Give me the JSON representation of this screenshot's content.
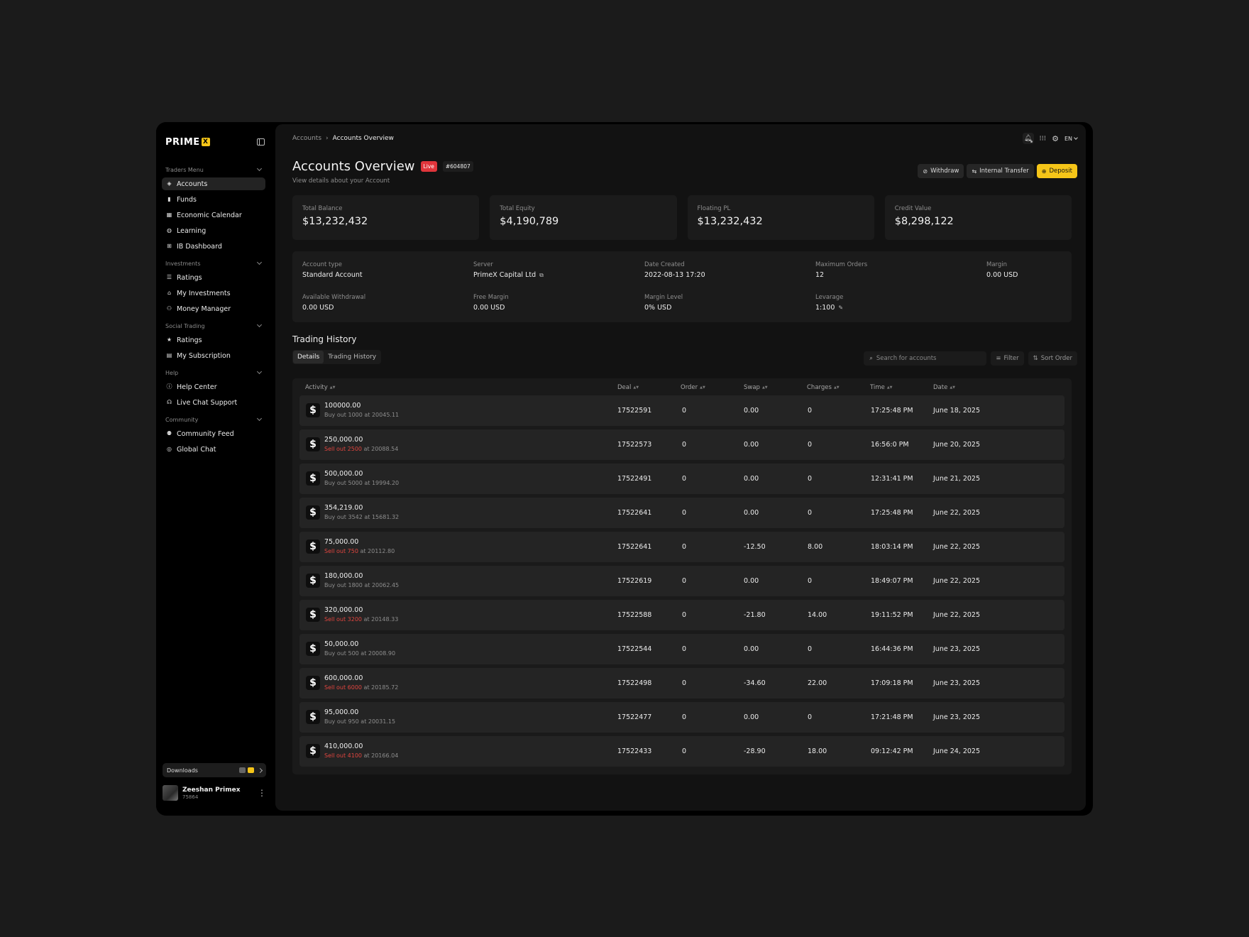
{
  "brand": {
    "logo_text": "PRIME",
    "logo_mark": "X"
  },
  "sidebar": {
    "sections": [
      {
        "label": "Traders Menu",
        "items": [
          {
            "label": "Accounts",
            "icon": "layers-icon",
            "active": true
          },
          {
            "label": "Funds",
            "icon": "chart-icon"
          },
          {
            "label": "Economic Calendar",
            "icon": "calendar-icon"
          },
          {
            "label": "Learning",
            "icon": "book-icon"
          },
          {
            "label": "IB Dashboard",
            "icon": "dashboard-icon"
          }
        ]
      },
      {
        "label": "Investments",
        "items": [
          {
            "label": "Ratings",
            "icon": "list-icon"
          },
          {
            "label": "My Investments",
            "icon": "bank-icon"
          },
          {
            "label": "Money Manager",
            "icon": "users-icon"
          }
        ]
      },
      {
        "label": "Social Trading",
        "items": [
          {
            "label": "Ratings",
            "icon": "star-icon"
          },
          {
            "label": "My Subscription",
            "icon": "subscription-icon"
          }
        ]
      },
      {
        "label": "Help",
        "items": [
          {
            "label": "Help Center",
            "icon": "help-icon"
          },
          {
            "label": "Live Chat Support",
            "icon": "headset-icon"
          }
        ]
      },
      {
        "label": "Community",
        "items": [
          {
            "label": "Community Feed",
            "icon": "people-icon"
          },
          {
            "label": "Global Chat",
            "icon": "globe-icon"
          }
        ]
      }
    ],
    "downloads_label": "Downloads",
    "user": {
      "name": "Zeeshan Primex",
      "id": "75864"
    }
  },
  "breadcrumb": {
    "parent": "Accounts",
    "separator": "›",
    "current": "Accounts Overview"
  },
  "topbar": {
    "language": "EN"
  },
  "header": {
    "title": "Accounts Overview",
    "status_badge": "Live",
    "account_number": "#604807",
    "subtitle": "View details about your Account",
    "withdraw_label": "Withdraw",
    "transfer_label": "Internal Transfer",
    "deposit_label": "Deposit"
  },
  "stats": [
    {
      "label": "Total Balance",
      "value": "$13,232,432"
    },
    {
      "label": "Total Equity",
      "value": "$4,190,789"
    },
    {
      "label": "Floating PL",
      "value": "$13,232,432"
    },
    {
      "label": "Credit Value",
      "value": "$8,298,122"
    }
  ],
  "account_details": {
    "account_type": {
      "label": "Account type",
      "value": "Standard Account"
    },
    "server": {
      "label": "Server",
      "value": "PrimeX Capital Ltd"
    },
    "date_created": {
      "label": "Date Created",
      "value": "2022-08-13 17:20"
    },
    "max_orders": {
      "label": "Maximum Orders",
      "value": "12"
    },
    "margin": {
      "label": "Margin",
      "value": "0.00 USD"
    },
    "available_withdrawal": {
      "label": "Available Withdrawal",
      "value": "0.00 USD"
    },
    "free_margin": {
      "label": "Free Margin",
      "value": "0.00 USD"
    },
    "margin_level": {
      "label": "Margin Level",
      "value": "0% USD"
    },
    "leverage": {
      "label": "Levarage",
      "value": "1:100"
    }
  },
  "trading": {
    "title": "Trading History",
    "tabs": [
      "Details",
      "Trading History"
    ],
    "search_placeholder": "Search for accounts",
    "filter_label": "Filter",
    "sort_label": "Sort Order",
    "columns": [
      "Activity",
      "Deal",
      "Order",
      "Swap",
      "Charges",
      "Time",
      "Date"
    ],
    "rows": [
      {
        "amount": "100000.00",
        "side": "Buy",
        "qty_text": "Buy out 1000",
        "price_text": " at 20045.11",
        "deal": "17522591",
        "order": "0",
        "swap": "0.00",
        "charges": "0",
        "time": "17:25:48 PM",
        "date": "June 18, 2025"
      },
      {
        "amount": "250,000.00",
        "side": "Sell",
        "qty_text": "Sell out 2500",
        "price_text": " at 20088.54",
        "deal": "17522573",
        "order": "0",
        "swap": "0.00",
        "charges": "0",
        "time": "16:56:0 PM",
        "date": "June 20, 2025"
      },
      {
        "amount": "500,000.00",
        "side": "Buy",
        "qty_text": "Buy out 5000",
        "price_text": " at 19994.20",
        "deal": "17522491",
        "order": "0",
        "swap": "0.00",
        "charges": "0",
        "time": "12:31:41 PM",
        "date": "June 21, 2025"
      },
      {
        "amount": "354,219.00",
        "side": "Buy",
        "qty_text": "Buy out 3542",
        "price_text": " at 15681.32",
        "deal": "17522641",
        "order": "0",
        "swap": "0.00",
        "charges": "0",
        "time": "17:25:48 PM",
        "date": "June 22, 2025"
      },
      {
        "amount": "75,000.00",
        "side": "Sell",
        "qty_text": "Sell out 750",
        "price_text": " at 20112.80",
        "deal": "17522641",
        "order": "0",
        "swap": "-12.50",
        "charges": "8.00",
        "time": "18:03:14 PM",
        "date": "June 22, 2025"
      },
      {
        "amount": "180,000.00",
        "side": "Buy",
        "qty_text": "Buy out 1800",
        "price_text": " at 20062.45",
        "deal": "17522619",
        "order": "0",
        "swap": "0.00",
        "charges": "0",
        "time": "18:49:07 PM",
        "date": "June 22, 2025"
      },
      {
        "amount": "320,000.00",
        "side": "Sell",
        "qty_text": "Sell out 3200",
        "price_text": " at 20148.33",
        "deal": "17522588",
        "order": "0",
        "swap": "-21.80",
        "charges": "14.00",
        "time": "19:11:52 PM",
        "date": "June 22, 2025"
      },
      {
        "amount": "50,000.00",
        "side": "Buy",
        "qty_text": "Buy out 500",
        "price_text": " at 20008.90",
        "deal": "17522544",
        "order": "0",
        "swap": "0.00",
        "charges": "0",
        "time": "16:44:36 PM",
        "date": "June 23, 2025"
      },
      {
        "amount": "600,000.00",
        "side": "Sell",
        "qty_text": "Sell out 6000",
        "price_text": " at 20185.72",
        "deal": "17522498",
        "order": "0",
        "swap": "-34.60",
        "charges": "22.00",
        "time": "17:09:18 PM",
        "date": "June 23, 2025"
      },
      {
        "amount": "95,000.00",
        "side": "Buy",
        "qty_text": "Buy out 950",
        "price_text": " at 20031.15",
        "deal": "17522477",
        "order": "0",
        "swap": "0.00",
        "charges": "0",
        "time": "17:21:48 PM",
        "date": "June 23, 2025"
      },
      {
        "amount": "410,000.00",
        "side": "Sell",
        "qty_text": "Sell out 4100",
        "price_text": " at 20166.04",
        "deal": "17522433",
        "order": "0",
        "swap": "-28.90",
        "charges": "18.00",
        "time": "09:12:42 PM",
        "date": "June 24, 2025"
      }
    ]
  },
  "colors": {
    "accent": "#f5c518",
    "live": "#e0353b",
    "sell": "#e0453f",
    "background": "#1b1b1b",
    "panel": "#121212"
  }
}
